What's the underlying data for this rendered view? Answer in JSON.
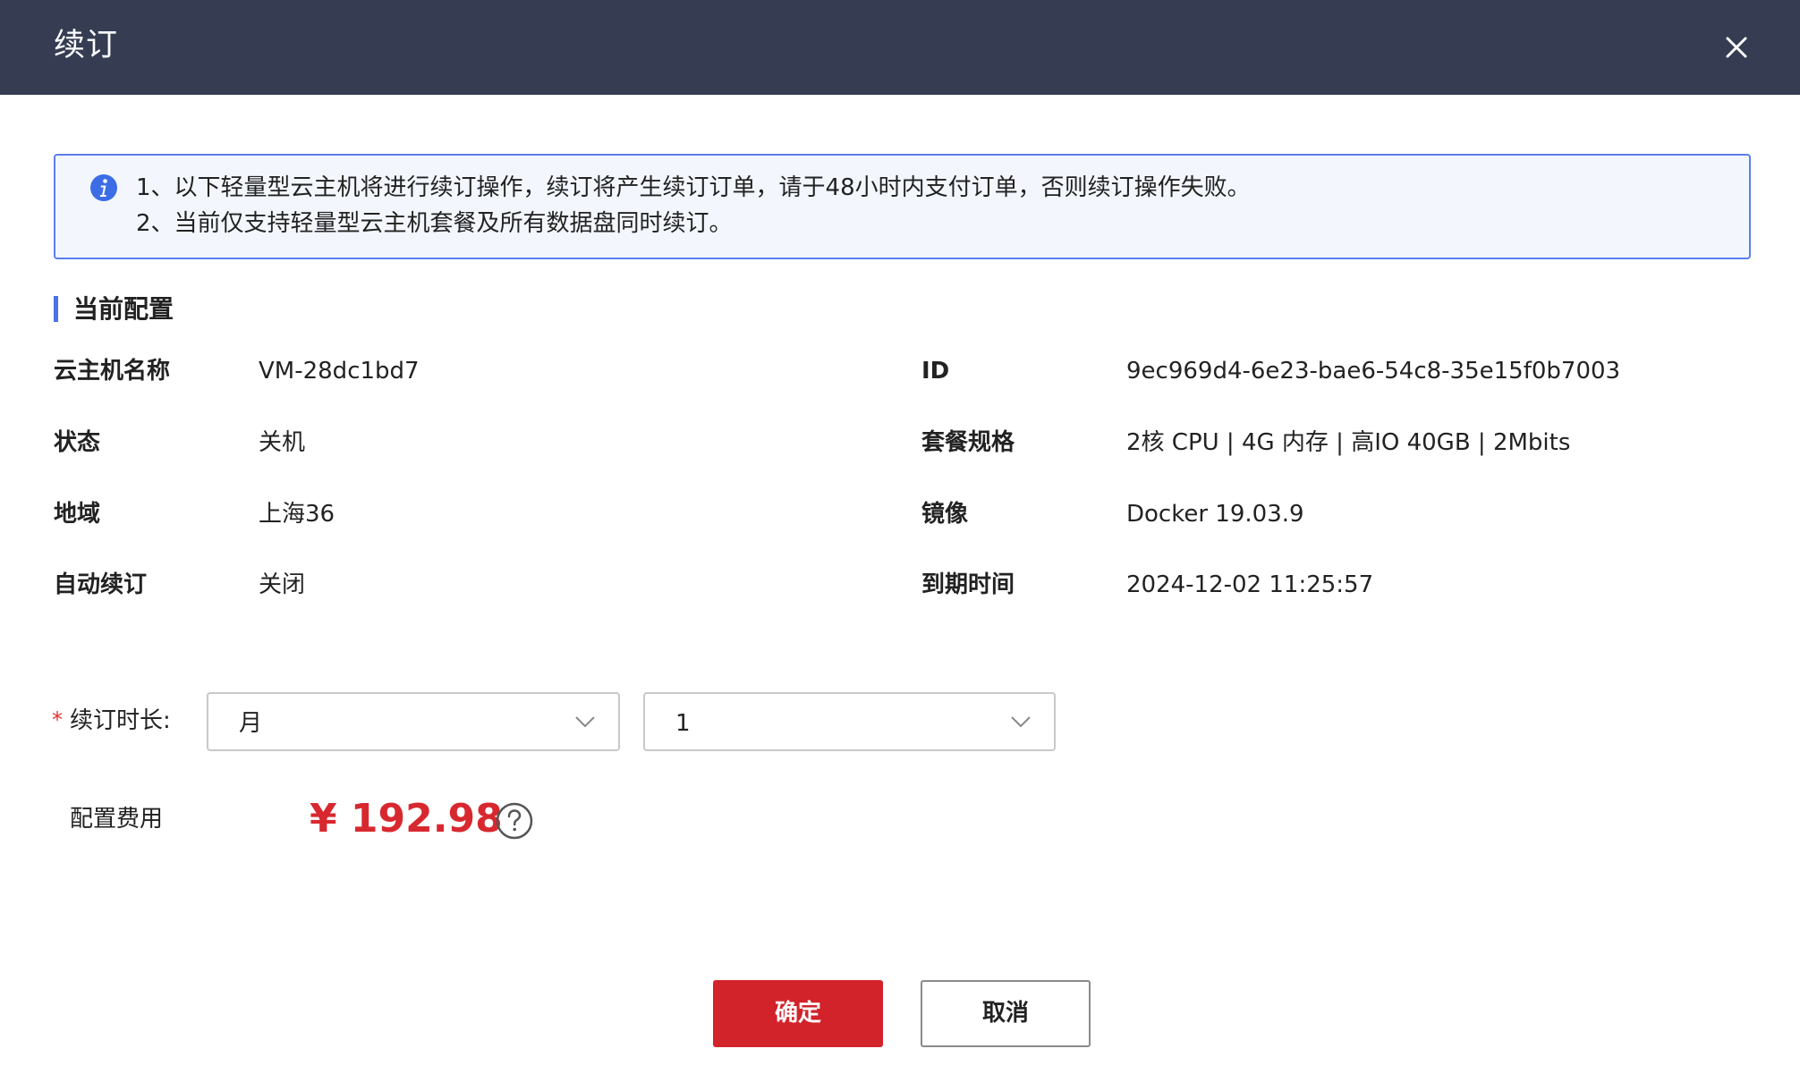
{
  "dialog": {
    "title": "续订",
    "close_icon": "close-icon"
  },
  "notice": {
    "icon": "info-icon",
    "line1": "1、以下轻量型云主机将进行续订操作，续订将产生续订订单，请于48小时内支付订单，否则续订操作失败。",
    "line2": "2、当前仅支持轻量型云主机套餐及所有数据盘同时续订。",
    "border_color": "#5b7ef0",
    "background": "#f3f7fd"
  },
  "section": {
    "title": "当前配置",
    "accent_color": "#4a73e8"
  },
  "config": {
    "left": [
      {
        "label": "云主机名称",
        "value": "VM-28dc1bd7"
      },
      {
        "label": "状态",
        "value": "关机"
      },
      {
        "label": "地域",
        "value": "上海36"
      },
      {
        "label": "自动续订",
        "value": "关闭"
      }
    ],
    "right": [
      {
        "label": "ID",
        "value": "9ec969d4-6e23-bae6-54c8-35e15f0b7003"
      },
      {
        "label": "套餐规格",
        "value": "2核 CPU | 4G 内存 | 高IO 40GB | 2Mbits"
      },
      {
        "label": "镜像",
        "value": "Docker 19.03.9"
      },
      {
        "label": "到期时间",
        "value": "2024-12-02 11:25:57"
      }
    ]
  },
  "duration": {
    "required_mark": "*",
    "label": "续订时长:",
    "unit_select": {
      "value": "月",
      "icon": "chevron-down-icon"
    },
    "count_select": {
      "value": "1",
      "icon": "chevron-down-icon"
    }
  },
  "fee": {
    "label": "配置费用",
    "amount": "¥ 192.98",
    "amount_color": "#d8282f",
    "help_icon": "question-circle-icon"
  },
  "actions": {
    "confirm_label": "确定",
    "cancel_label": "取消",
    "confirm_color": "#d2232a"
  },
  "colors": {
    "header_background": "#363d53"
  }
}
